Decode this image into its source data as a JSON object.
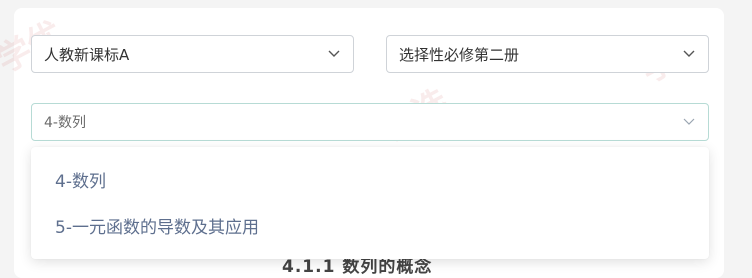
{
  "filters": {
    "edition": {
      "value": "人教新课标A"
    },
    "book": {
      "value": "选择性必修第二册"
    },
    "chapter": {
      "value": "4-数列",
      "options": [
        "4-数列",
        "5-一元函数的导数及其应用"
      ]
    }
  },
  "content": {
    "heading": "4.1.1 数列的概念"
  },
  "watermark": {
    "text": "学科网"
  },
  "colors": {
    "option_text": "#5e6f8e",
    "focus_border": "#b7dbd5"
  }
}
